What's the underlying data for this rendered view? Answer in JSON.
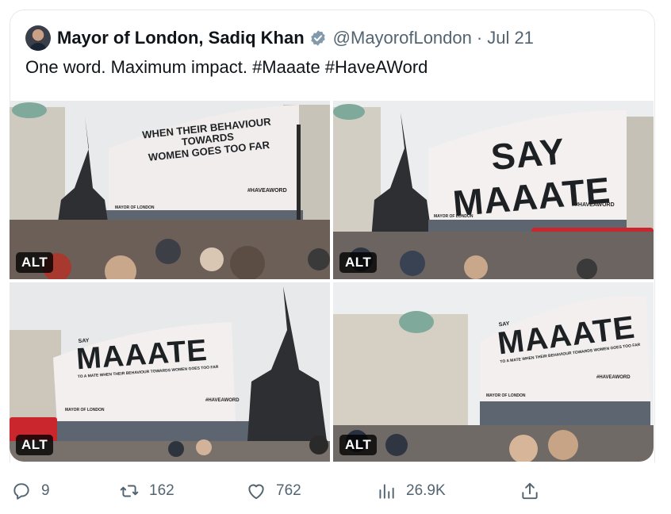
{
  "tweet": {
    "author_name": "Mayor of London, Sadiq Khan",
    "handle": "@MayorofLondon",
    "separator": "·",
    "date": "Jul 21",
    "text": "One word. Maximum impact. #Maaate #HaveAWord",
    "verified_color": "#829aab"
  },
  "media": [
    {
      "alt_label": "ALT",
      "billboard_line1": "WHEN THEIR BEHAVIOUR TOWARDS",
      "billboard_line2": "WOMEN GOES TOO FAR",
      "hashtag": "#HAVEAWORD",
      "credit": "MAYOR OF LONDON"
    },
    {
      "alt_label": "ALT",
      "billboard_headline": "SAY MAAATE",
      "hashtag": "#HAVEAWORD",
      "credit": "MAYOR OF LONDON"
    },
    {
      "alt_label": "ALT",
      "billboard_small": "SAY",
      "billboard_headline": "MAAATE",
      "billboard_sub": "TO A MATE WHEN THEIR BEHAVIOUR TOWARDS WOMEN GOES TOO FAR",
      "hashtag": "#HAVEAWORD",
      "credit": "MAYOR OF LONDON"
    },
    {
      "alt_label": "ALT",
      "billboard_small": "SAY",
      "billboard_headline": "MAAATE",
      "billboard_sub": "TO A MATE WHEN THEIR BEHAVIOUR TOWARDS WOMEN GOES TOO FAR",
      "hashtag": "#HAVEAWORD",
      "credit": "MAYOR OF LONDON"
    }
  ],
  "actions": {
    "replies": "9",
    "reposts": "162",
    "likes": "762",
    "views": "26.9K"
  },
  "icons": [
    "verified-badge-icon",
    "reply-icon",
    "repost-icon",
    "like-icon",
    "views-icon",
    "share-icon"
  ]
}
